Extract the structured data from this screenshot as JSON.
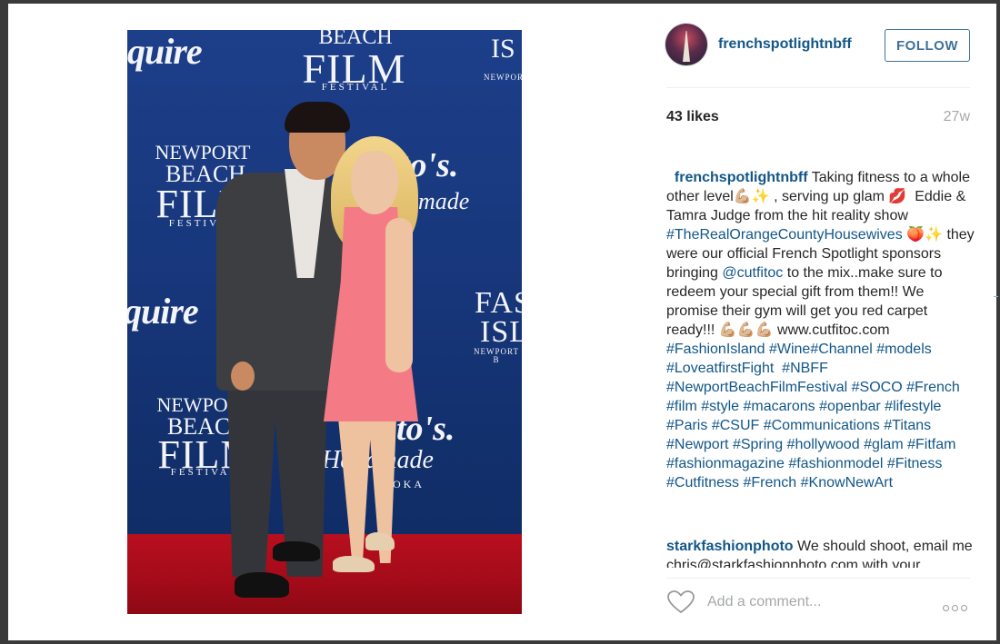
{
  "post": {
    "username": "frenchspotlightnbff",
    "follow_label": "FOLLOW",
    "likes": "43 likes",
    "age": "27w",
    "caption": {
      "user": "frenchspotlightnbff",
      "text_parts": [
        {
          "t": " Taking fitness to a whole other level💪🏼✨ , serving up glam 💋  Eddie & Tamra Judge from the hit reality show ",
          "k": "text"
        },
        {
          "t": "#TheRealOrangeCountyHousewives",
          "k": "tag"
        },
        {
          "t": " 🍑✨ they were our official French Spotlight sponsors bringing ",
          "k": "text"
        },
        {
          "t": "@cutfitoc",
          "k": "tag"
        },
        {
          "t": " to the mix..make sure to redeem your special gift from them!! We promise their gym will get you red carpet ready!!! 💪🏼💪🏼💪🏼 www.cutfitoc.com ",
          "k": "text"
        },
        {
          "t": "#FashionIsland",
          "k": "tag"
        },
        {
          "t": " ",
          "k": "text"
        },
        {
          "t": "#Wine#Channel",
          "k": "tag"
        },
        {
          "t": " ",
          "k": "text"
        },
        {
          "t": "#models",
          "k": "tag"
        },
        {
          "t": " ",
          "k": "text"
        },
        {
          "t": "#LoveatfirstFight",
          "k": "tag"
        },
        {
          "t": "  ",
          "k": "text"
        },
        {
          "t": "#NBFF",
          "k": "tag"
        },
        {
          "t": "  ",
          "k": "text"
        },
        {
          "t": "#NewportBeachFilmFestival",
          "k": "tag"
        },
        {
          "t": " ",
          "k": "text"
        },
        {
          "t": "#SOCO",
          "k": "tag"
        },
        {
          "t": " ",
          "k": "text"
        },
        {
          "t": "#French",
          "k": "tag"
        },
        {
          "t": " ",
          "k": "text"
        },
        {
          "t": "#film",
          "k": "tag"
        },
        {
          "t": " ",
          "k": "text"
        },
        {
          "t": "#style",
          "k": "tag"
        },
        {
          "t": " ",
          "k": "text"
        },
        {
          "t": "#macarons",
          "k": "tag"
        },
        {
          "t": " ",
          "k": "text"
        },
        {
          "t": "#openbar",
          "k": "tag"
        },
        {
          "t": " ",
          "k": "text"
        },
        {
          "t": "#lifestyle",
          "k": "tag"
        },
        {
          "t": " ",
          "k": "text"
        },
        {
          "t": "#Paris",
          "k": "tag"
        },
        {
          "t": " ",
          "k": "text"
        },
        {
          "t": "#CSUF",
          "k": "tag"
        },
        {
          "t": " ",
          "k": "text"
        },
        {
          "t": "#Communications",
          "k": "tag"
        },
        {
          "t": " ",
          "k": "text"
        },
        {
          "t": "#Titans",
          "k": "tag"
        },
        {
          "t": " ",
          "k": "text"
        },
        {
          "t": "#Newport",
          "k": "tag"
        },
        {
          "t": " ",
          "k": "text"
        },
        {
          "t": "#Spring",
          "k": "tag"
        },
        {
          "t": " ",
          "k": "text"
        },
        {
          "t": "#hollywood",
          "k": "tag"
        },
        {
          "t": " ",
          "k": "text"
        },
        {
          "t": "#glam",
          "k": "tag"
        },
        {
          "t": " ",
          "k": "text"
        },
        {
          "t": "#Fitfam",
          "k": "tag"
        },
        {
          "t": " ",
          "k": "text"
        },
        {
          "t": "#fashionmagazine",
          "k": "tag"
        },
        {
          "t": " ",
          "k": "text"
        },
        {
          "t": "#fashionmodel",
          "k": "tag"
        },
        {
          "t": " ",
          "k": "text"
        },
        {
          "t": "#Fitness",
          "k": "tag"
        },
        {
          "t": " ",
          "k": "text"
        },
        {
          "t": "#Cutfitness",
          "k": "tag"
        },
        {
          "t": " ",
          "k": "text"
        },
        {
          "t": "#French",
          "k": "tag"
        },
        {
          "t": " ",
          "k": "text"
        },
        {
          "t": "#KnowNewArt",
          "k": "tag"
        }
      ]
    },
    "comment": {
      "user": "starkfashionphoto",
      "text": " We should shoot, email me chris@starkfashionphoto.com with your"
    },
    "add_comment_placeholder": "Add a comment...",
    "icons": {
      "heart": "heart-icon",
      "more": "more-options-icon"
    }
  },
  "photo": {
    "backdrop": {
      "esquire": "quire",
      "esquire2": "quire",
      "beach": "BEACH",
      "film": "FILM",
      "festival": "FESTIVAL",
      "newport": "NEWPORT",
      "fash": "FAS",
      "isl": "ISL",
      "newport_b": "NEWPORT B",
      "is": "IS",
      "newport_top": "NEWPORT",
      "tos": "to's.",
      "made": "made",
      "handmade": "Handmade",
      "oka": "OKA"
    }
  },
  "colors": {
    "link": "#125688",
    "follow": "#3f729b",
    "muted": "#a5a7aa"
  }
}
